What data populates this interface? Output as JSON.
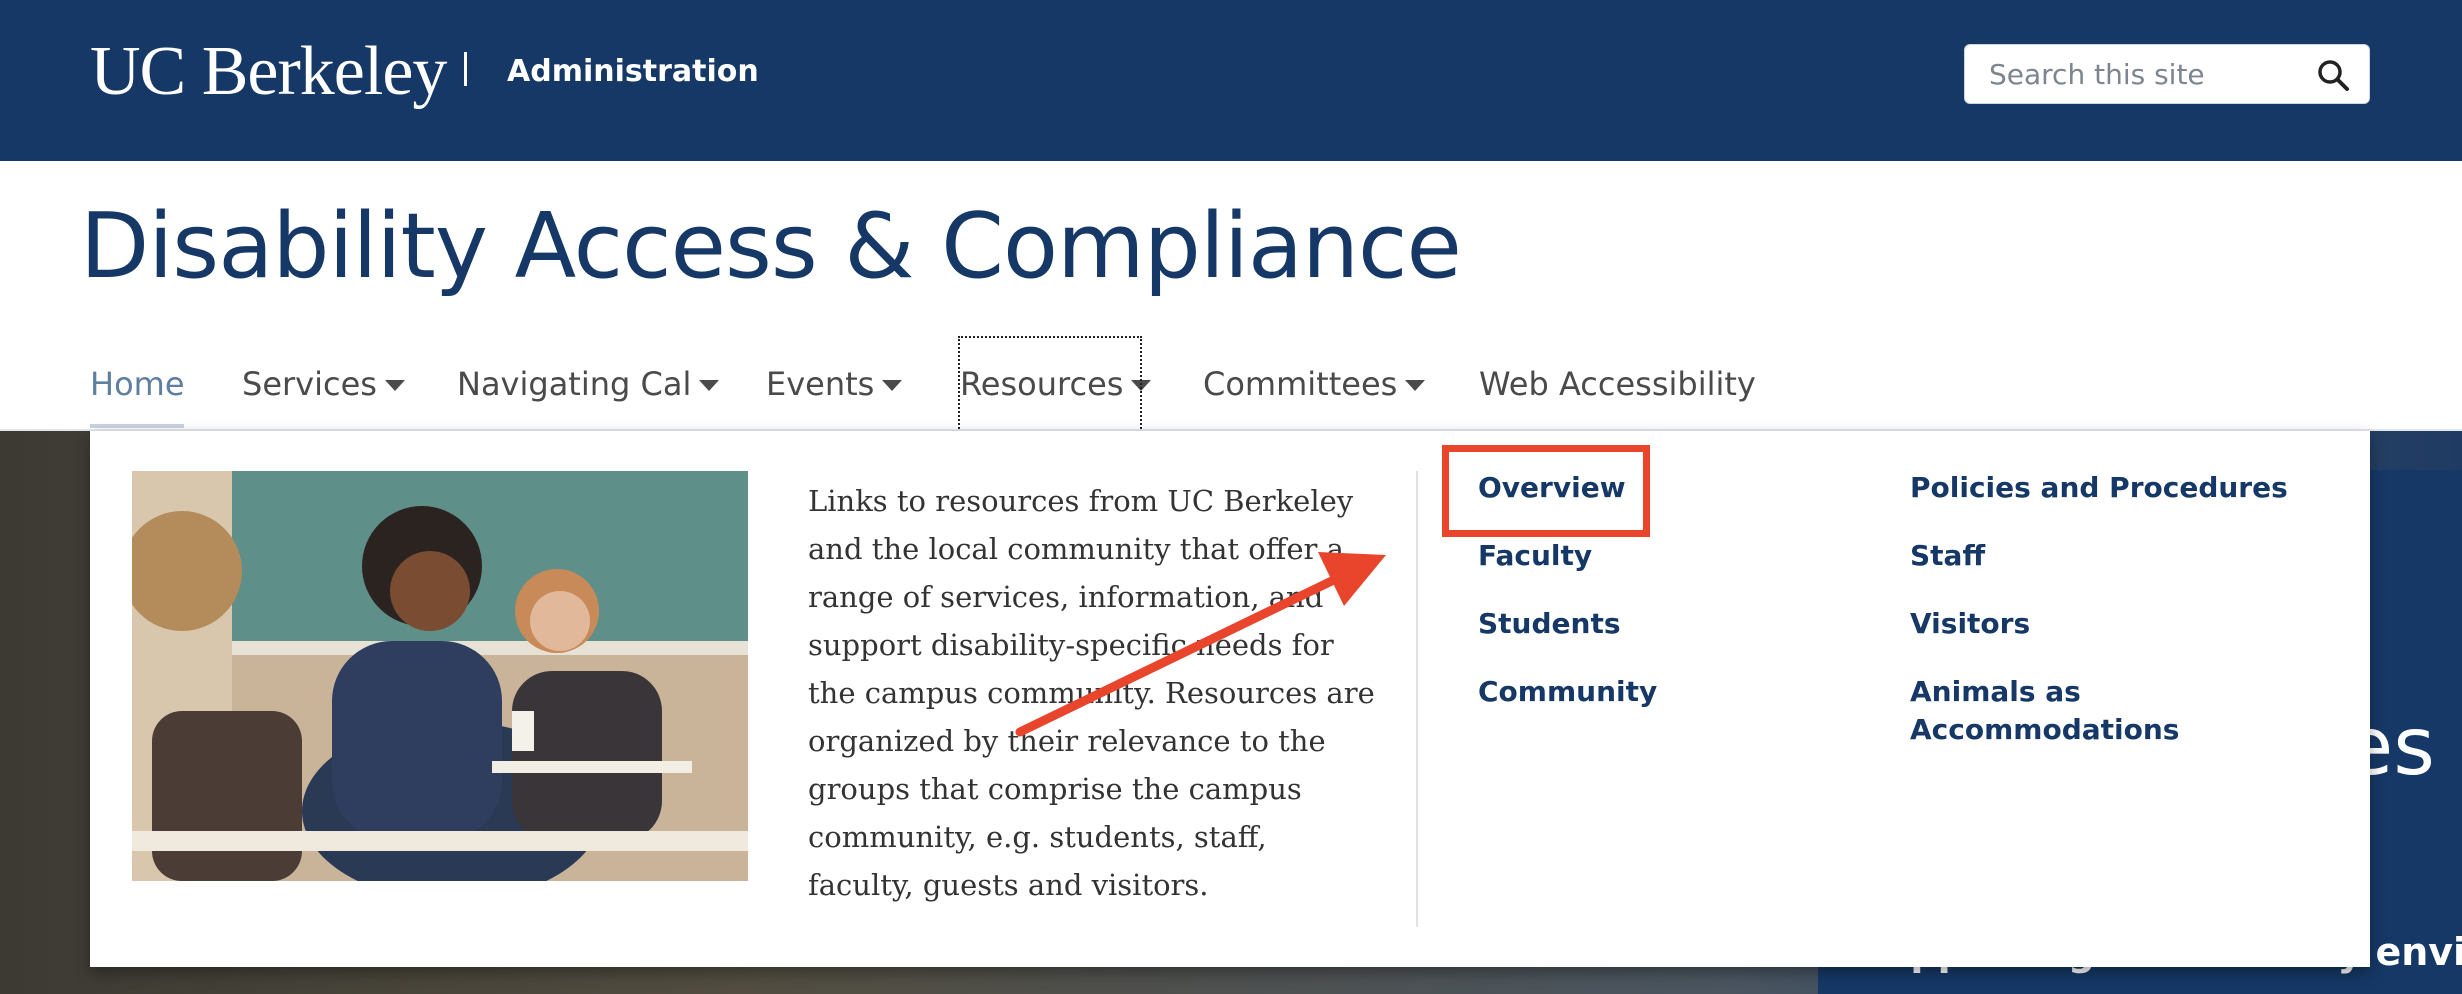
{
  "header": {
    "brand": "UC Berkeley",
    "section": "Administration",
    "search": {
      "placeholder": "Search this site",
      "icon": "search-icon"
    }
  },
  "site_title": "Disability Access & Compliance",
  "nav": {
    "items": [
      {
        "label": "Home",
        "active": true,
        "has_dropdown": false
      },
      {
        "label": "Services",
        "has_dropdown": true
      },
      {
        "label": "Navigating Cal",
        "has_dropdown": true
      },
      {
        "label": "Events",
        "has_dropdown": true
      },
      {
        "label": "Resources",
        "has_dropdown": true,
        "focused": true
      },
      {
        "label": "Committees",
        "has_dropdown": true
      },
      {
        "label": "Web Accessibility",
        "has_dropdown": false
      }
    ]
  },
  "dropdown": {
    "description": "Links to resources from UC Berkeley and the local community that offer a range of services, information, and support disability-specific needs for the campus community. Resources are organized by their relevance to the groups that comprise the campus community, e.g. students, staff, faculty, guests and visitors.",
    "links_col1": [
      "Overview",
      "Faculty",
      "Students",
      "Community"
    ],
    "links_col2": [
      "Policies and Procedures",
      "Staff",
      "Visitors",
      "Animals as Accommodations"
    ],
    "highlighted": "Overview"
  },
  "hero": {
    "text_fragment": "ces",
    "subtitle_fragment": "Supporting a university environn"
  },
  "colors": {
    "brand_navy": "#163866",
    "annotation_red": "#e8452c",
    "nav_text": "#4a4a4a",
    "active_nav": "#5f7fa1"
  }
}
